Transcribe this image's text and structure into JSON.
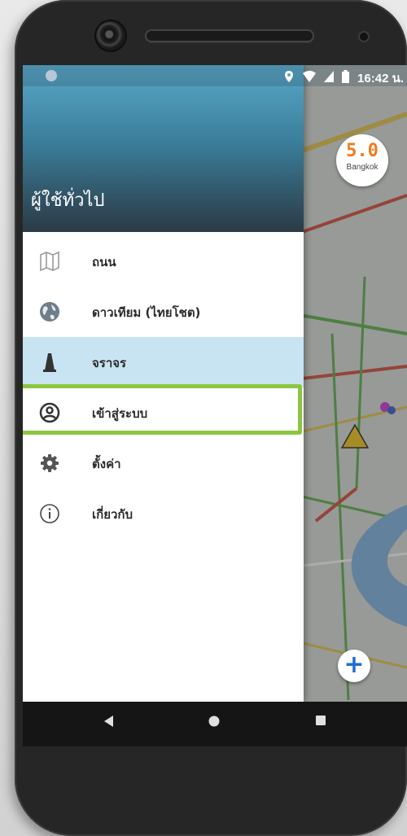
{
  "status_bar": {
    "time": "16:42 น."
  },
  "map": {
    "speed_value": "5.0",
    "city_label": "Bangkok",
    "zoom_button": "+"
  },
  "drawer": {
    "user_label": "ผู้ใช้ทั่วไป",
    "items": [
      {
        "label": "ถนน",
        "icon": "map-icon"
      },
      {
        "label": "ดาวเทียม (ไทยโชต)",
        "icon": "globe-icon"
      },
      {
        "label": "จราจร",
        "icon": "traffic-cone-icon",
        "active": true
      },
      {
        "label": "เข้าสู่ระบบ",
        "icon": "account-circle-icon",
        "highlighted": true
      },
      {
        "label": "ตั้งค่า",
        "icon": "gear-icon"
      },
      {
        "label": "เกี่ยวกับ",
        "icon": "info-icon"
      }
    ]
  },
  "colors": {
    "active_item_bg": "#c8e4f2",
    "highlight_border": "#8cc63f",
    "speed_color": "#f07a1e"
  },
  "nav": {
    "back": "back-triangle-icon",
    "home": "home-circle-icon",
    "recents": "recents-square-icon"
  }
}
